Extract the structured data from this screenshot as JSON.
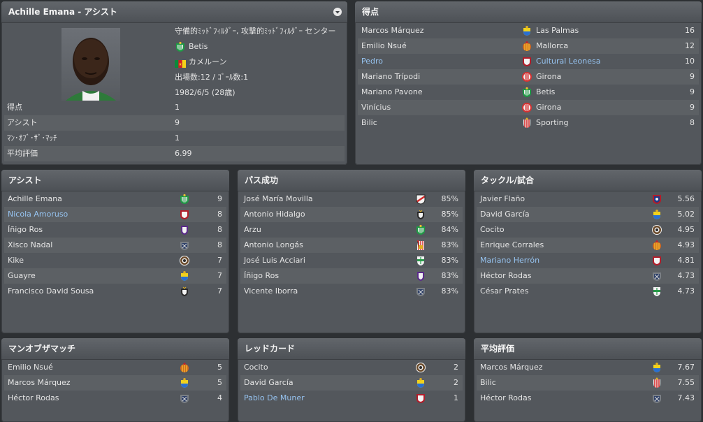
{
  "profile": {
    "title": "Achille Emana - アシスト",
    "positions": "守備的ﾐｯﾄﾞﾌｨﾙﾀﾞｰ, 攻撃的ﾐｯﾄﾞﾌｨﾙﾀﾞｰ センター",
    "club": "Betis",
    "nation": "カメルーン",
    "apps_goals": "出場数:12 / ｺﾞｰﾙ数:1",
    "dob": "1982/6/5 (28歳)",
    "stats": [
      {
        "label": "得点",
        "value": "1"
      },
      {
        "label": "アシスト",
        "value": "9"
      },
      {
        "label": "ﾏﾝ･ｵﾌﾞ･ｻﾞ･ﾏｯﾁ",
        "value": "1"
      },
      {
        "label": "平均評価",
        "value": "6.99"
      }
    ]
  },
  "scorers": {
    "title": "得点",
    "rows": [
      {
        "name": "Marcos Márquez",
        "club": "Las Palmas",
        "value": "16",
        "crest": "las-palmas",
        "link": false
      },
      {
        "name": "Emilio Nsué",
        "club": "Mallorca",
        "value": "12",
        "crest": "mallorca",
        "link": false
      },
      {
        "name": "Pedro",
        "club": "Cultural Leonesa",
        "value": "10",
        "crest": "cultural",
        "link": true
      },
      {
        "name": "Mariano Trípodi",
        "club": "Girona",
        "value": "9",
        "crest": "girona",
        "link": false
      },
      {
        "name": "Mariano Pavone",
        "club": "Betis",
        "value": "9",
        "crest": "betis",
        "link": false
      },
      {
        "name": "Vinícius",
        "club": "Girona",
        "value": "9",
        "crest": "girona",
        "link": false
      },
      {
        "name": "Bilic",
        "club": "Sporting",
        "value": "8",
        "crest": "sporting",
        "link": false
      }
    ]
  },
  "assists": {
    "title": "アシスト",
    "rows": [
      {
        "name": "Achille Emana",
        "value": "9",
        "crest": "betis",
        "link": false
      },
      {
        "name": "Nicola Amoruso",
        "value": "8",
        "crest": "cultural",
        "link": true
      },
      {
        "name": "Íñigo Ros",
        "value": "8",
        "crest": "purple",
        "link": false
      },
      {
        "name": "Xisco Nadal",
        "value": "8",
        "crest": "huesca",
        "link": false
      },
      {
        "name": "Kike",
        "value": "7",
        "crest": "round",
        "link": false
      },
      {
        "name": "Guayre",
        "value": "7",
        "crest": "las-palmas",
        "link": false
      },
      {
        "name": "Francisco David Sousa",
        "value": "7",
        "crest": "dark",
        "link": false
      }
    ]
  },
  "passes": {
    "title": "パス成功",
    "rows": [
      {
        "name": "José María Movilla",
        "value": "85%",
        "crest": "rayo",
        "link": false
      },
      {
        "name": "Antonio Hidalgo",
        "value": "85%",
        "crest": "dark",
        "link": false
      },
      {
        "name": "Arzu",
        "value": "84%",
        "crest": "betis",
        "link": false
      },
      {
        "name": "Antonio Longás",
        "value": "83%",
        "crest": "castle",
        "link": false
      },
      {
        "name": "José Luis Acciari",
        "value": "83%",
        "crest": "elche",
        "link": false
      },
      {
        "name": "Íñigo Ros",
        "value": "83%",
        "crest": "purple",
        "link": false
      },
      {
        "name": "Vicente Iborra",
        "value": "83%",
        "crest": "huesca",
        "link": false
      }
    ]
  },
  "tackles": {
    "title": "タックル/試合",
    "rows": [
      {
        "name": "Javier Flaño",
        "value": "5.56",
        "crest": "numancia",
        "link": false
      },
      {
        "name": "David García",
        "value": "5.02",
        "crest": "las-palmas",
        "link": false
      },
      {
        "name": "Cocito",
        "value": "4.95",
        "crest": "round",
        "link": false
      },
      {
        "name": "Enrique Corrales",
        "value": "4.93",
        "crest": "mallorca",
        "link": false
      },
      {
        "name": "Mariano Herrón",
        "value": "4.81",
        "crest": "cultural",
        "link": true
      },
      {
        "name": "Héctor Rodas",
        "value": "4.73",
        "crest": "huesca",
        "link": false
      },
      {
        "name": "César Prates",
        "value": "4.73",
        "crest": "elche",
        "link": false
      }
    ]
  },
  "motm": {
    "title": "マンオブザマッチ",
    "rows": [
      {
        "name": "Emilio Nsué",
        "value": "5",
        "crest": "mallorca",
        "link": false
      },
      {
        "name": "Marcos Márquez",
        "value": "5",
        "crest": "las-palmas",
        "link": false
      },
      {
        "name": "Héctor Rodas",
        "value": "4",
        "crest": "huesca",
        "link": false
      }
    ]
  },
  "redcards": {
    "title": "レッドカード",
    "rows": [
      {
        "name": "Cocito",
        "value": "2",
        "crest": "round",
        "link": false
      },
      {
        "name": "David García",
        "value": "2",
        "crest": "las-palmas",
        "link": false
      },
      {
        "name": "Pablo De Muner",
        "value": "1",
        "crest": "cultural",
        "link": true
      }
    ]
  },
  "avgrating": {
    "title": "平均評価",
    "rows": [
      {
        "name": "Marcos Márquez",
        "value": "7.67",
        "crest": "las-palmas",
        "link": false
      },
      {
        "name": "Bilic",
        "value": "7.55",
        "crest": "sporting",
        "link": false
      },
      {
        "name": "Héctor Rodas",
        "value": "7.43",
        "crest": "huesca",
        "link": false
      }
    ]
  }
}
